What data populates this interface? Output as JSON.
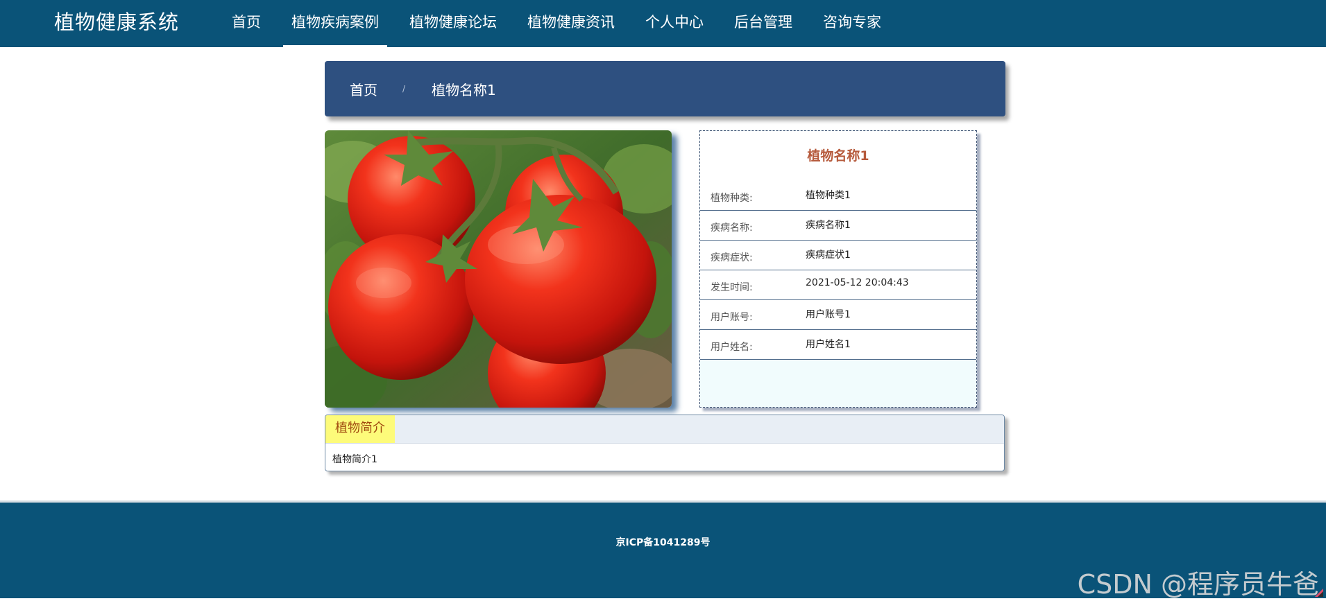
{
  "header": {
    "brand": "植物健康系统",
    "nav": [
      {
        "label": "首页",
        "active": false
      },
      {
        "label": "植物疾病案例",
        "active": true
      },
      {
        "label": "植物健康论坛",
        "active": false
      },
      {
        "label": "植物健康资讯",
        "active": false
      },
      {
        "label": "个人中心",
        "active": false
      },
      {
        "label": "后台管理",
        "active": false
      },
      {
        "label": "咨询专家",
        "active": false
      }
    ]
  },
  "breadcrumb": {
    "home": "首页",
    "separator": "/",
    "current": "植物名称1"
  },
  "detail": {
    "title": "植物名称1",
    "rows": [
      {
        "label": "植物种类:",
        "value": "植物种类1"
      },
      {
        "label": "疾病名称:",
        "value": "疾病名称1"
      },
      {
        "label": "疾病症状:",
        "value": "疾病症状1"
      },
      {
        "label": "发生时间:",
        "value": "2021-05-12 20:04:43"
      },
      {
        "label": "用户账号:",
        "value": "用户账号1"
      },
      {
        "label": "用户姓名:",
        "value": "用户姓名1"
      }
    ]
  },
  "intro": {
    "tab": "植物简介",
    "content": "植物简介1"
  },
  "footer": {
    "icp": "京ICP备1041289号",
    "watermark": "CSDN @程序员牛爸"
  },
  "colors": {
    "header_bg": "#0a5378",
    "breadcrumb_bg": "#2e5080",
    "title_accent": "#b65a3c",
    "tab_bg": "#fdfb7a"
  }
}
